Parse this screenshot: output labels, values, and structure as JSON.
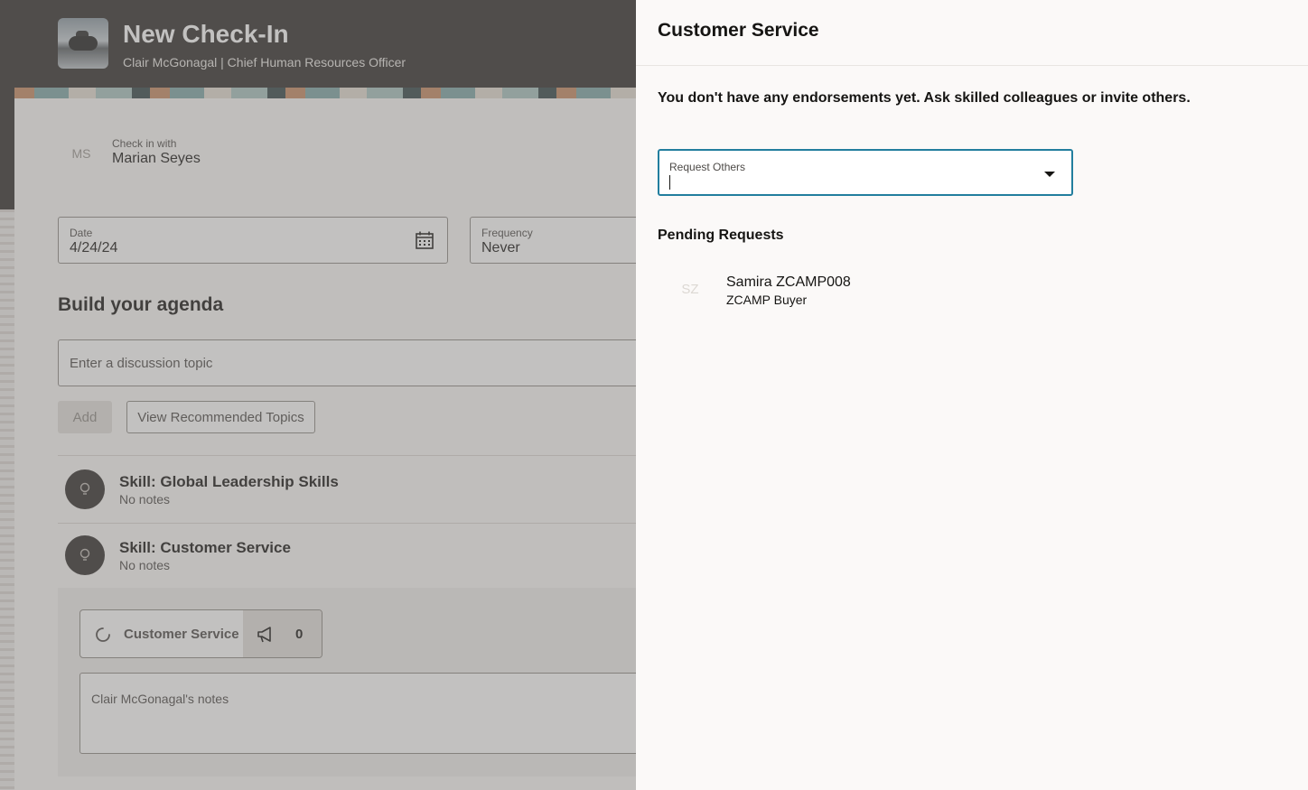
{
  "page": {
    "title": "New Check-In",
    "subtitle": "Clair McGonagal | Chief Human Resources Officer"
  },
  "checkin": {
    "label": "Check in with",
    "name": "Marian Seyes",
    "avatar_initials": "MS"
  },
  "date_field": {
    "label": "Date",
    "value": "4/24/24"
  },
  "frequency_field": {
    "label": "Frequency",
    "value": "Never"
  },
  "agenda": {
    "title": "Build your agenda",
    "topic_placeholder": "Enter a discussion topic",
    "add_label": "Add",
    "recommended_label": "View Recommended Topics"
  },
  "skills": [
    {
      "title": "Skill: Global Leadership Skills",
      "notes": "No notes"
    },
    {
      "title": "Skill: Customer Service",
      "notes": "No notes"
    }
  ],
  "expanded_skill": {
    "chip_label": "Customer Service",
    "endorsement_count": "0",
    "notes_label": "Clair McGonagal's notes"
  },
  "drawer": {
    "title": "Customer Service",
    "message": "You don't have any endorsements yet. Ask skilled colleagues or invite others.",
    "request_label": "Request Others",
    "request_value": "",
    "pending_title": "Pending Requests",
    "pending": [
      {
        "initials": "SZ",
        "name": "Samira ZCAMP008",
        "role": "ZCAMP Buyer"
      }
    ]
  },
  "colors": {
    "header_bg": "#312d2a",
    "focus_border": "#227e9e",
    "drawer_bg": "#fbf9f8"
  }
}
